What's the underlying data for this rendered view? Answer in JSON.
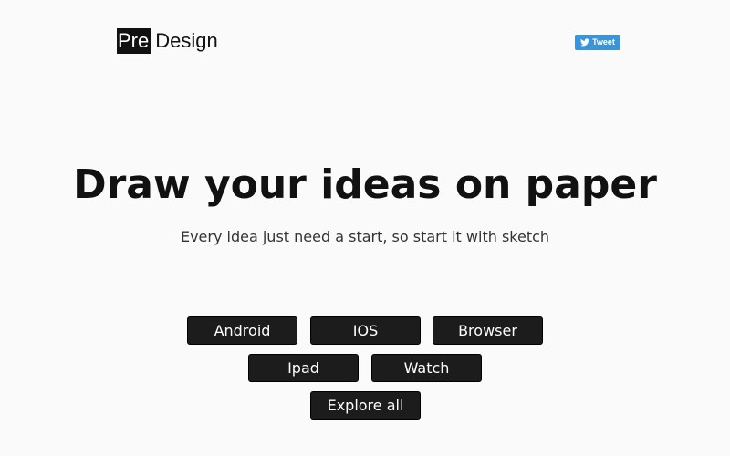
{
  "header": {
    "logo_box_text": "Pre",
    "logo_text": "Design",
    "tweet_label": "Tweet"
  },
  "hero": {
    "title": "Draw your ideas on paper",
    "subtitle": "Every idea just need a start, so start it with sketch"
  },
  "platforms": {
    "android": "Android",
    "ios": "IOS",
    "browser": "Browser",
    "ipad": "Ipad",
    "watch": "Watch",
    "explore_all": "Explore all"
  },
  "colors": {
    "background": "#fafafa",
    "text": "#111111",
    "button": "#1c1c1c",
    "tweet": "#3b94d9"
  },
  "icons": {
    "tweet": "twitter-bird-icon"
  }
}
